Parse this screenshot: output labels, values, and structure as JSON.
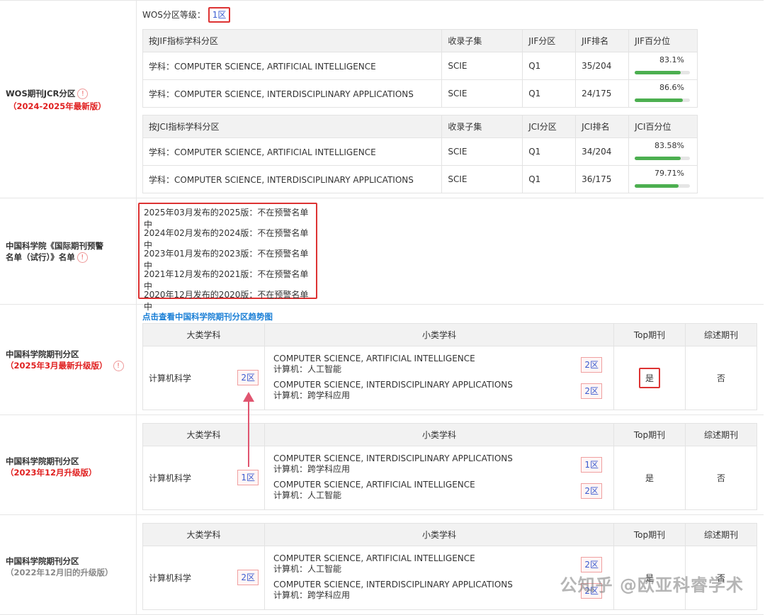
{
  "wos": {
    "label": "WOS期刊JCR分区",
    "sublabel": "（2024-2025年最新版）",
    "grade_label": "WOS分区等级：",
    "grade_value": "1区",
    "jif_headers": [
      "按JIF指标学科分区",
      "收录子集",
      "JIF分区",
      "JIF排名",
      "JIF百分位"
    ],
    "jif_rows": [
      {
        "subject": "学科：COMPUTER SCIENCE, ARTIFICIAL INTELLIGENCE",
        "set": "SCIE",
        "q": "Q1",
        "rank": "35/204",
        "pct": "83.1%",
        "pct_num": 83.1
      },
      {
        "subject": "学科：COMPUTER SCIENCE, INTERDISCIPLINARY APPLICATIONS",
        "set": "SCIE",
        "q": "Q1",
        "rank": "24/175",
        "pct": "86.6%",
        "pct_num": 86.6
      }
    ],
    "jci_headers": [
      "按JCI指标学科分区",
      "收录子集",
      "JCI分区",
      "JCI排名",
      "JCI百分位"
    ],
    "jci_rows": [
      {
        "subject": "学科：COMPUTER SCIENCE, ARTIFICIAL INTELLIGENCE",
        "set": "SCIE",
        "q": "Q1",
        "rank": "34/204",
        "pct": "83.58%",
        "pct_num": 83.58
      },
      {
        "subject": "学科：COMPUTER SCIENCE, INTERDISCIPLINARY APPLICATIONS",
        "set": "SCIE",
        "q": "Q1",
        "rank": "36/175",
        "pct": "79.71%",
        "pct_num": 79.71
      }
    ]
  },
  "warning": {
    "label_line1": "中国科学院《国际期刊预警",
    "label_line2": "名单（试行）》名单",
    "lines": [
      "2025年03月发布的2025版：不在预警名单中",
      "2024年02月发布的2024版：不在预警名单中",
      "2023年01月发布的2023版：不在预警名单中",
      "2021年12月发布的2021版：不在预警名单中",
      "2020年12月发布的2020版：不在预警名单中"
    ]
  },
  "trend_link": "点击查看中国科学院期刊分区趋势图",
  "cas_headers": [
    "大类学科",
    "小类学科",
    "Top期刊",
    "综述期刊"
  ],
  "cas": [
    {
      "label": "中国科学院期刊分区",
      "sublabel": "（2025年3月最新升级版）",
      "major": "计算机科学",
      "major_zone": "2区",
      "subs": [
        {
          "en": "COMPUTER SCIENCE, ARTIFICIAL INTELLIGENCE",
          "cn": "计算机：人工智能",
          "zone": "2区"
        },
        {
          "en": "COMPUTER SCIENCE, INTERDISCIPLINARY APPLICATIONS",
          "cn": "计算机：跨学科应用",
          "zone": "2区"
        }
      ],
      "top": "是",
      "review": "否"
    },
    {
      "label": "中国科学院期刊分区",
      "sublabel": "（2023年12月升级版）",
      "major": "计算机科学",
      "major_zone": "1区",
      "subs": [
        {
          "en": "COMPUTER SCIENCE, INTERDISCIPLINARY APPLICATIONS",
          "cn": "计算机：跨学科应用",
          "zone": "1区"
        },
        {
          "en": "COMPUTER SCIENCE, ARTIFICIAL INTELLIGENCE",
          "cn": "计算机：人工智能",
          "zone": "2区"
        }
      ],
      "top": "是",
      "review": "否"
    },
    {
      "label": "中国科学院期刊分区",
      "sublabel": "（2022年12月旧的升级版）",
      "major": "计算机科学",
      "major_zone": "2区",
      "subs": [
        {
          "en": "COMPUTER SCIENCE, ARTIFICIAL INTELLIGENCE",
          "cn": "计算机：人工智能",
          "zone": "2区"
        },
        {
          "en": "COMPUTER SCIENCE, INTERDISCIPLINARY APPLICATIONS",
          "cn": "计算机：跨学科应用",
          "zone": "2区"
        }
      ],
      "top": "是",
      "review": "否"
    }
  ],
  "info_icon_glyph": "!",
  "watermark": "公知乎 @欧亚科睿学术",
  "colors": {
    "accent_red": "#d33333",
    "link_blue": "#1a7fd6",
    "bar_green": "#4caf50"
  }
}
